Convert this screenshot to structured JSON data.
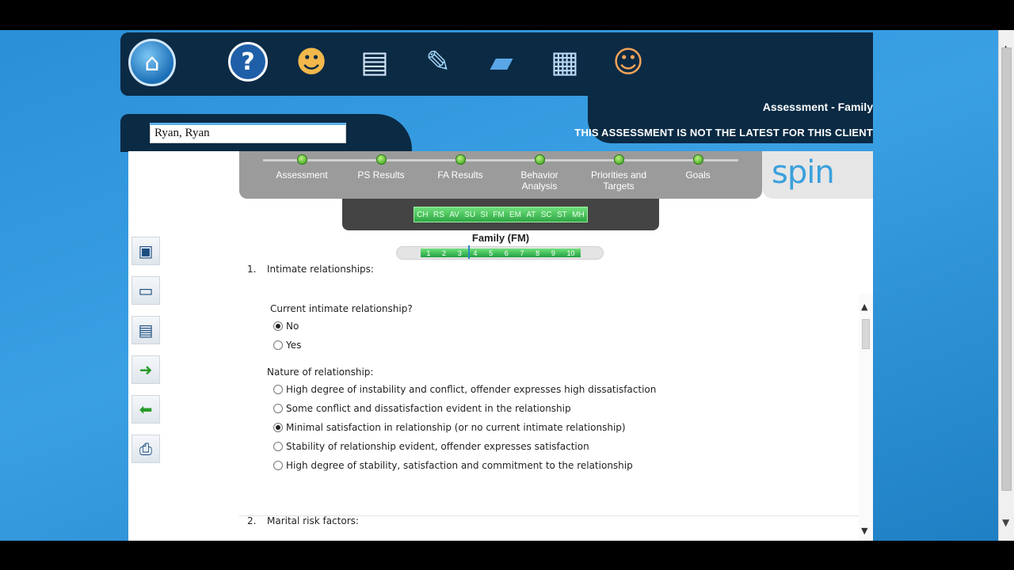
{
  "client": {
    "name": "Ryan, Ryan"
  },
  "header": {
    "title": "Assessment - Family",
    "warning": "THIS ASSESSMENT IS NOT THE LATEST FOR THIS CLIENT"
  },
  "nav_icons": [
    "home-icon",
    "help-icon",
    "clients-icon",
    "id-card-icon",
    "edit-notes-icon",
    "book-icon",
    "table-icon",
    "family-icon"
  ],
  "steps": [
    "Assessment",
    "PS Results",
    "FA Results",
    "Behavior Analysis",
    "Priorities and Targets",
    "Goals"
  ],
  "logo": "spin",
  "domains": [
    "CH",
    "RS",
    "AV",
    "SU",
    "SI",
    "FM",
    "EM",
    "AT",
    "SC",
    "ST",
    "MH"
  ],
  "section": {
    "title": "Family (FM)",
    "scale": [
      "1",
      "2",
      "3",
      "4",
      "5",
      "6",
      "7",
      "8",
      "9",
      "10"
    ]
  },
  "tools": [
    "save-icon",
    "window-icon",
    "window-edit-icon",
    "next-window-icon",
    "prev-window-icon",
    "print-icon"
  ],
  "questions": [
    {
      "number": "1.",
      "title": "Intimate relationships:",
      "sub1": {
        "label": "Current intimate relationship?",
        "options": [
          {
            "label": "No",
            "selected": true
          },
          {
            "label": "Yes",
            "selected": false
          }
        ]
      },
      "sub2": {
        "label": "Nature of relationship:",
        "options": [
          {
            "label": "High degree of instability and conflict, offender expresses high dissatisfaction",
            "selected": false
          },
          {
            "label": "Some conflict and dissatisfaction evident in the relationship",
            "selected": false
          },
          {
            "label": "Minimal satisfaction in relationship (or no current intimate relationship)",
            "selected": true
          },
          {
            "label": "Stability of relationship evident, offender expresses satisfaction",
            "selected": false
          },
          {
            "label": "High degree of stability, satisfaction and commitment to the relationship",
            "selected": false
          }
        ]
      }
    },
    {
      "number": "2.",
      "title": "Marital risk factors:"
    }
  ],
  "colors": {
    "navy": "#0b2a44",
    "accent_green": "#2ea745",
    "logo_blue": "#3aa0dc"
  }
}
